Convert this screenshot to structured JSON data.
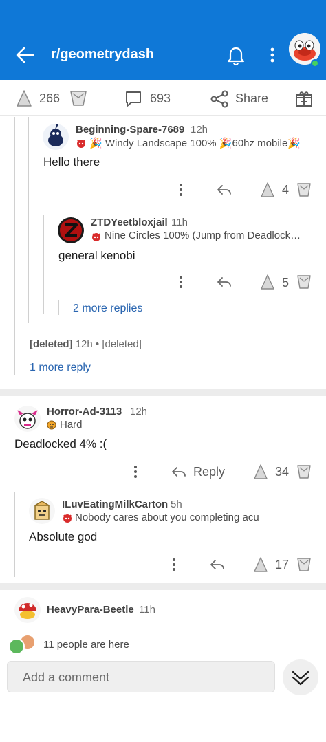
{
  "header": {
    "subreddit": "r/geometrydash"
  },
  "post_actions": {
    "upvotes": "266",
    "comments": "693",
    "share_label": "Share"
  },
  "comments": [
    {
      "user": "Beginning-Spare-7689",
      "time": "12h",
      "flair": "Windy Landscape 100% 🎉60hz mobile🎉",
      "body": "Hello there",
      "votes": "4"
    },
    {
      "user": "ZTDYeetbloxjail",
      "time": "11h",
      "flair": "Nine Circles 100% (Jump from Deadlock…",
      "body": "general kenobi",
      "votes": "5"
    }
  ],
  "more_replies_2": "2 more replies",
  "deleted": {
    "user": "[deleted]",
    "time": "12h",
    "dot": "•",
    "body": "[deleted]"
  },
  "one_more_reply": "1 more reply",
  "comment2": {
    "user": "Horror-Ad-3113",
    "time": "12h",
    "flair": "Hard",
    "body": "Deadlocked 4% :(",
    "reply_label": "Reply",
    "votes": "34"
  },
  "comment3": {
    "user": "ILuvEatingMilkCarton",
    "time": "5h",
    "flair": "Nobody cares about you completing acu",
    "body": "Absolute god",
    "votes": "17"
  },
  "comment4": {
    "user": "HeavyPara-Beetle",
    "time": "11h"
  },
  "bottom": {
    "presence": "11 people are here",
    "add_comment_placeholder": "Add a comment"
  },
  "colors": {
    "header_bg": "#0f78d7",
    "link": "#2965b0",
    "online": "#46d160"
  }
}
